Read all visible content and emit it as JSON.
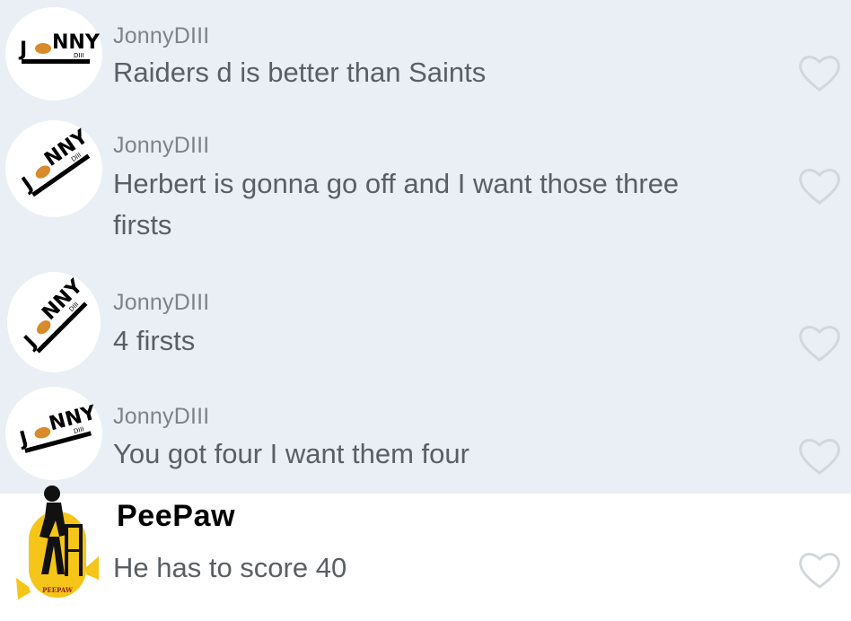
{
  "messages": [
    {
      "username": "JonnyDIII",
      "text": "Raiders d is better than Saints",
      "avatar_icon": "jonny-diii-logo-icon",
      "like_icon": "heart-outline-icon"
    },
    {
      "username": "JonnyDIII",
      "text": "Herbert is gonna go off and I want those three firsts",
      "avatar_icon": "jonny-diii-logo-icon",
      "like_icon": "heart-outline-icon"
    },
    {
      "username": "JonnyDIII",
      "text": "4 firsts",
      "avatar_icon": "jonny-diii-logo-icon",
      "like_icon": "heart-outline-icon"
    },
    {
      "username": "JonnyDIII",
      "text": "You got four I want them four",
      "avatar_icon": "jonny-diii-logo-icon",
      "like_icon": "heart-outline-icon"
    },
    {
      "username": "PeePaw",
      "text": "He has to score 40",
      "avatar_icon": "peepaw-walker-icon",
      "avatar_caption": "PEEPAW",
      "like_icon": "heart-outline-icon"
    }
  ],
  "logo": {
    "letters": [
      "J",
      "NNY"
    ],
    "sub": "DIII"
  },
  "colors": {
    "thread_bg": "#e9eff5",
    "highlight_bg": "#ffffff",
    "username_gray": "#7d8388",
    "message_text": "#5a5f63",
    "heart_stroke": "#d3d7db",
    "football": "#d98a2b",
    "peepaw_yellow": "#f5c518"
  }
}
